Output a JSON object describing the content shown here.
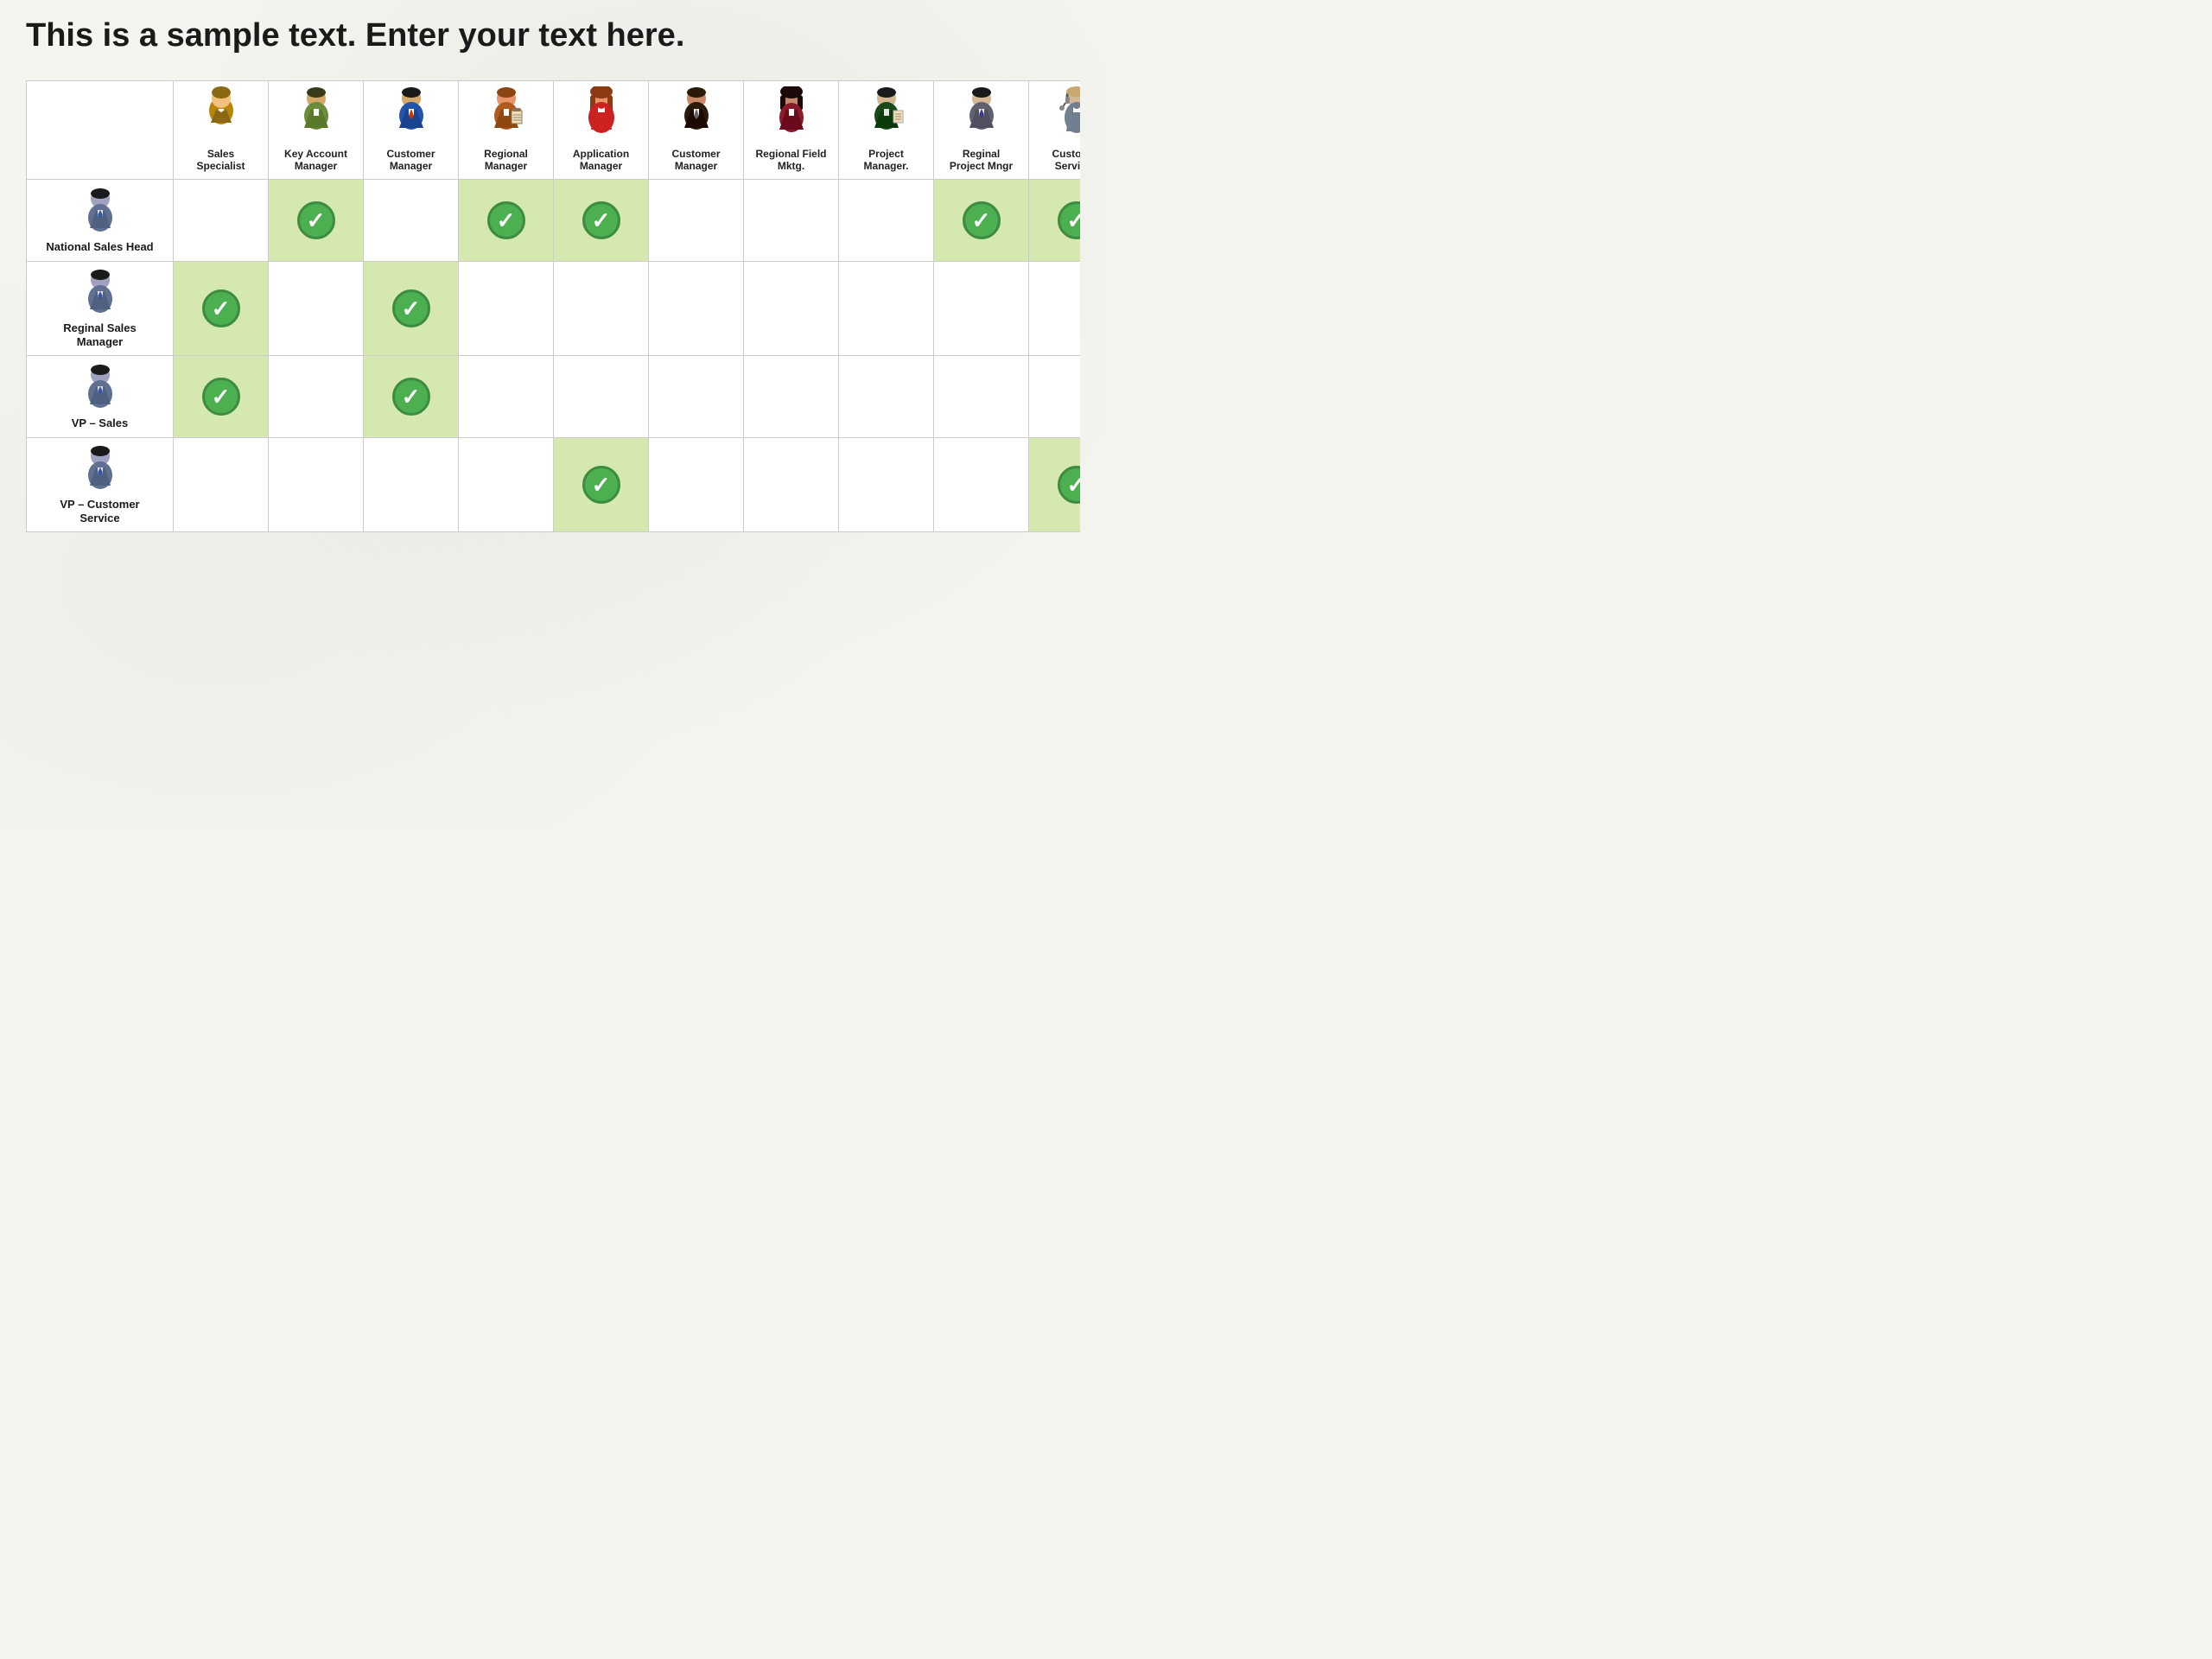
{
  "page": {
    "title": "This is a sample text. Enter your text here."
  },
  "columns": [
    {
      "id": "sales-specialist",
      "label": "Sales\nSpecialist",
      "color": "#c8a84b"
    },
    {
      "id": "key-account-manager",
      "label": "Key Account\nManager",
      "color": "#7b8c5a"
    },
    {
      "id": "customer-manager",
      "label": "Customer\nManager",
      "color": "#3a6fa0"
    },
    {
      "id": "regional-manager",
      "label": "Regional\nManager",
      "color": "#b05a2a"
    },
    {
      "id": "application-manager",
      "label": "Application\nManager",
      "color": "#a03030"
    },
    {
      "id": "customer-manager-2",
      "label": "Customer\nManager",
      "color": "#704830"
    },
    {
      "id": "regional-field-mktg",
      "label": "Regional Field\nMktg.",
      "color": "#702050"
    },
    {
      "id": "project-manager",
      "label": "Project\nManager.",
      "color": "#205020"
    },
    {
      "id": "reginal-project-mngr",
      "label": "Reginal\nProject Mngr",
      "color": "#505070"
    },
    {
      "id": "customer-services",
      "label": "Customer\nServices",
      "color": "#507090"
    }
  ],
  "rows": [
    {
      "id": "national-sales-head",
      "label": "National Sales Head",
      "checks": [
        false,
        true,
        false,
        true,
        true,
        false,
        false,
        false,
        true,
        true
      ]
    },
    {
      "id": "reginal-sales-manager",
      "label": "Reginal Sales\nManager",
      "checks": [
        true,
        false,
        true,
        false,
        false,
        false,
        false,
        false,
        false,
        false
      ]
    },
    {
      "id": "vp-sales",
      "label": "VP – Sales",
      "checks": [
        true,
        false,
        true,
        false,
        false,
        false,
        false,
        false,
        false,
        false
      ]
    },
    {
      "id": "vp-customer-service",
      "label": "VP – Customer\nService",
      "checks": [
        false,
        false,
        false,
        false,
        true,
        false,
        false,
        false,
        false,
        true
      ]
    }
  ]
}
